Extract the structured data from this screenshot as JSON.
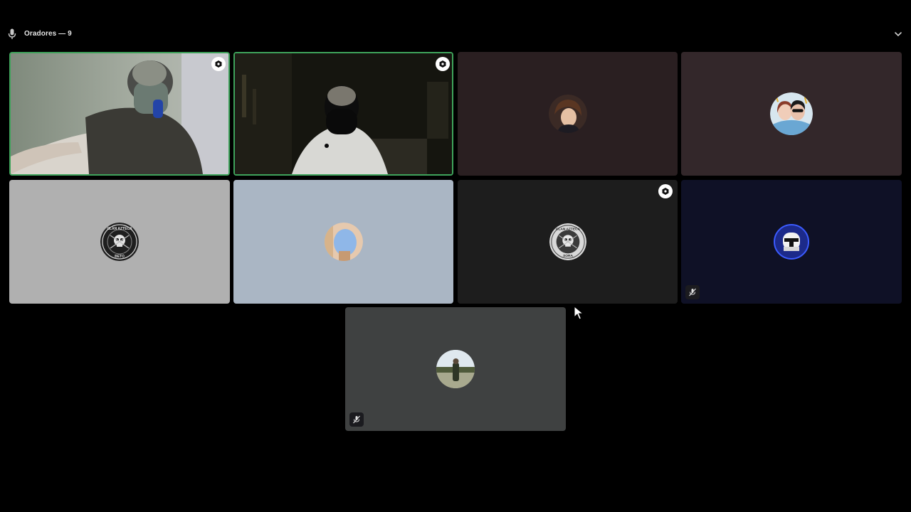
{
  "header": {
    "title": "Oradores — 9",
    "icon": "microphone-icon",
    "collapse_icon": "chevron-down-icon"
  },
  "participants": [
    {
      "id": "p1",
      "video": true,
      "speaking": true,
      "badge": "stream-badge-icon",
      "bg": "#9aa39a"
    },
    {
      "id": "p2",
      "video": true,
      "speaking": true,
      "badge": "stream-badge-icon",
      "bg": "#1a1a14"
    },
    {
      "id": "p3",
      "video": false,
      "bg": "#2a1f21",
      "avatar": "anime-boy-avatar"
    },
    {
      "id": "p4",
      "video": false,
      "bg": "#33272a",
      "avatar": "couple-avatar"
    },
    {
      "id": "p5",
      "video": false,
      "bg": "#b0b0b0",
      "avatar": "clan-azteca-skull-avatar",
      "avatar_text": [
        "CLAN AZTECA",
        "BETO"
      ]
    },
    {
      "id": "p6",
      "video": false,
      "bg": "#aab6c4",
      "avatar": "blue-drawing-avatar"
    },
    {
      "id": "p7",
      "video": false,
      "bg": "#1d1d1d",
      "avatar": "clan-azteca-skull-avatar",
      "badge": "stream-badge-icon",
      "avatar_text": [
        "CLAN AZTECA",
        "SORA"
      ]
    },
    {
      "id": "p8",
      "video": false,
      "bg": "#0f1126",
      "avatar": "clone-trooper-avatar",
      "muted": true
    },
    {
      "id": "p9",
      "video": false,
      "bg": "#3f4141",
      "avatar": "landscape-photo-avatar",
      "muted": true
    }
  ],
  "colors": {
    "speaking_border": "#3fa35b",
    "background": "#000000"
  }
}
